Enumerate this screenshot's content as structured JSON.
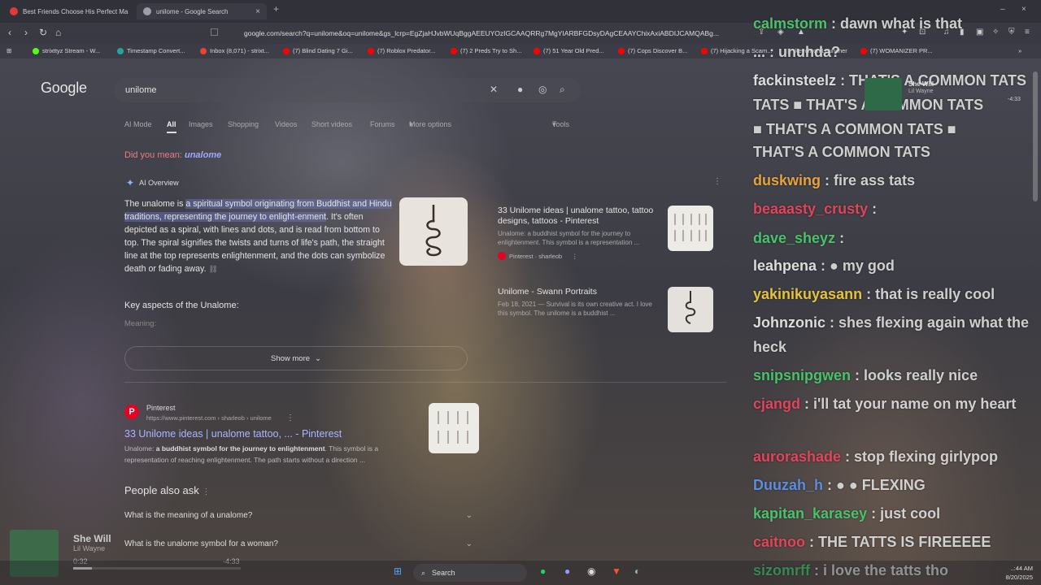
{
  "tabs": [
    {
      "title": "Best Friends Choose His Perfect Ma",
      "color": "#e53935"
    },
    {
      "title": "unilome - Google Search",
      "color": "#9aa0a6"
    }
  ],
  "address": {
    "url": "google.com/search?q=unilome&oq=unilome&gs_lcrp=EgZjaHJvbWUqBggAEEUYOzIGCAAQRRg7MgYIARBFGDsyDAgCEAAYChixAxiABDIJCAMQABg..."
  },
  "bookmarks": [
    {
      "label": "strixttyz Stream - W...",
      "color": "#53fc18"
    },
    {
      "label": "Timestamp Convert...",
      "color": "#26a69a"
    },
    {
      "label": "Inbox (8,071) - strixt...",
      "color": "#ea4335"
    },
    {
      "label": "(7) Blind Dating 7 Gi...",
      "color": "#ff0000"
    },
    {
      "label": "(7) Roblox Predator...",
      "color": "#ff0000"
    },
    {
      "label": "(7) 2 Preds Try to Sh...",
      "color": "#ff0000"
    },
    {
      "label": "(7) 51 Year Old Pred...",
      "color": "#ff0000"
    },
    {
      "label": "(7) Cops Discover B...",
      "color": "#ff0000"
    },
    {
      "label": "(7) Hijacking a Scam...",
      "color": "#ff0000"
    },
    {
      "label": "keychron Launcher",
      "color": "#555555"
    },
    {
      "label": "(7) WOMANIZER PR...",
      "color": "#ff0000"
    }
  ],
  "google": {
    "logo": "Google",
    "query": "unilome",
    "tabs": [
      "AI Mode",
      "All",
      "Images",
      "Shopping",
      "Videos",
      "Short videos",
      "Forums",
      "More options",
      "Tools"
    ],
    "dym_prefix": "Did you mean: ",
    "dym_term": "unalome",
    "aio_label": "AI Overview",
    "aio_parts": {
      "p1": "The unalome is ",
      "h1": "a spiritual symbol originating from Buddhist and Hindu traditions, representing",
      "p2": " the journey to enlight-enment",
      "p3": ". It's often depicted as a spiral, with lines and dots, and is read from bottom to top. The spiral signifies the twists and turns of life's path, the straight line at the top represents enlightenment, and the dots can symbolize death or fading away."
    },
    "key_aspects": "Key aspects of the Unalome:",
    "meaning": "Meaning:",
    "show_more": "Show more",
    "side_cards": [
      {
        "title": "33 Unilome ideas | unalome tattoo, tattoo designs, tattoos - Pinterest",
        "snippet": "Unalome: a buddhist symbol for the journey to enlightenment. This symbol is a representation ...",
        "source": "Pinterest · sharleob"
      },
      {
        "title": "Unilome - Swann Portraits",
        "snippet": "Feb 18, 2021 — Survival is its own creative act. I love this symbol. The unilome is a buddhist ...",
        "source": ""
      }
    ],
    "result": {
      "site": "Pinterest",
      "url": "https://www.pinterest.com › sharleob › unilome",
      "title": "33 Unilome ideas | unalome tattoo, ... - Pinterest",
      "snippet_pre": "Unalome: ",
      "snippet_bold": "a buddhist symbol for the journey to enlightenment",
      "snippet_post": ". This symbol is a representation of reaching enlightenment. The path starts without a direction ..."
    },
    "paa_title": "People also ask",
    "paa": [
      "What is the meaning of a unalome?",
      "What is the unalome symbol for a woman?"
    ]
  },
  "chat": [
    {
      "user": "calmstorm",
      "text": " : dawn what is that",
      "color": "#49c26b"
    },
    {
      "user": "",
      "text": "... : unuhda?",
      "color": "#dddddd"
    },
    {
      "user": "fackinsteelz",
      "text": " : THAT'S A COMMON TATS",
      "color": "#dddddd"
    },
    {
      "user": "",
      "text": "TATS ■ THAT'S A COMMON TATS",
      "color": "#dddddd"
    },
    {
      "user": "",
      "text": "■ THAT'S A COMMON TATS ■",
      "color": "#dddddd"
    },
    {
      "user": "",
      "text": "THAT'S A COMMON TATS",
      "color": "#dddddd"
    },
    {
      "user": "duskwing",
      "text": " : fire ass tats",
      "color": "#e6a23c"
    },
    {
      "user": "beaaasty_crusty",
      "text": " :",
      "color": "#e0455b"
    },
    {
      "user": "dave_sheyz",
      "text": " :",
      "color": "#49c26b"
    },
    {
      "user": "leahpena",
      "text": " : ● my god",
      "color": "#dddddd"
    },
    {
      "user": "yakinikuyasann",
      "text": " : that is really cool",
      "color": "#e6c23c"
    },
    {
      "user": "Johnzonic",
      "text": " : shes flexing again what the heck",
      "color": "#dddddd"
    },
    {
      "user": "snipsnipgwen",
      "text": " : looks really nice",
      "color": "#49c26b"
    },
    {
      "user": "cjangd",
      "text": " : i'll tat your name on my heart",
      "color": "#e0455b"
    },
    {
      "user": "aurorashade",
      "text": " : stop flexing girlypop",
      "color": "#e0455b"
    },
    {
      "user": "Duuzah_h",
      "text": " : ● ● FLEXING",
      "color": "#5b8de0"
    },
    {
      "user": "kapitan_karasey",
      "text": " : just cool",
      "color": "#49c26b"
    },
    {
      "user": "caitnoo",
      "text": " : THE TATTS IS FIREEEEE",
      "color": "#e0455b"
    },
    {
      "user": "sizomrff",
      "text": " : i love the tatts tho",
      "color": "#49c26b"
    }
  ],
  "now_playing": {
    "title": "She Will",
    "artist": "Lil Wayne",
    "remaining": "-4:33"
  },
  "player": {
    "title": "She Will",
    "artist": "Lil Wayne",
    "elapsed": "0:32",
    "remaining": "-4:33",
    "progress": 0.11
  },
  "taskbar": {
    "search": "Search",
    "time": "..:44 AM",
    "date": "8/20/2025"
  }
}
